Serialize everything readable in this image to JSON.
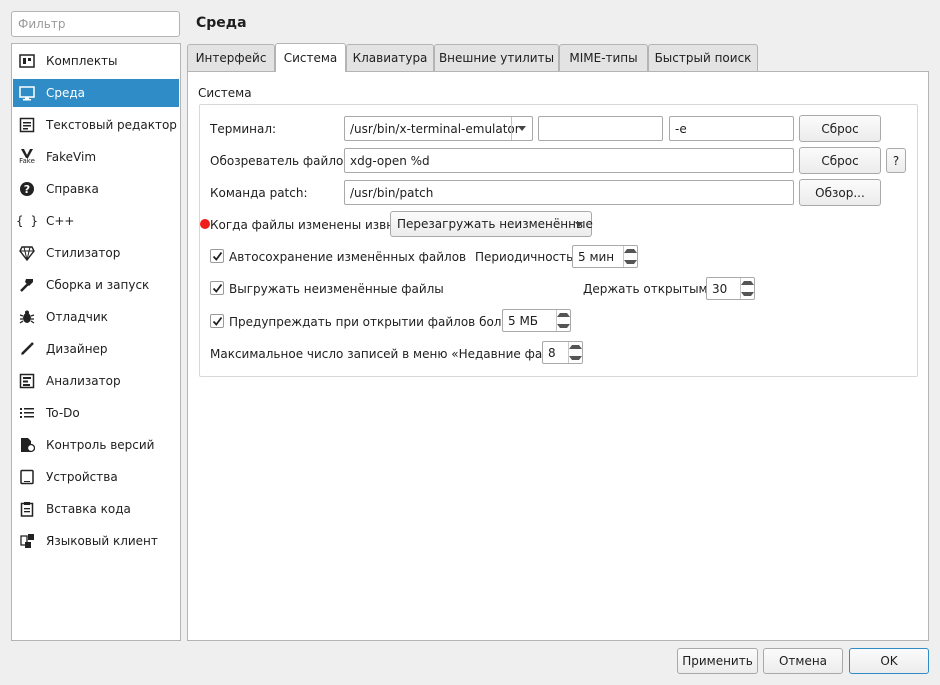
{
  "filter": {
    "placeholder": "Фильтр"
  },
  "sidebar": {
    "items": [
      {
        "label": "Комплекты",
        "icon": "kits-icon"
      },
      {
        "label": "Среда",
        "icon": "monitor-icon"
      },
      {
        "label": "Текстовый редактор",
        "icon": "text-editor-icon"
      },
      {
        "label": "FakeVim",
        "icon": "fakevim-icon",
        "icon_text": "Fake"
      },
      {
        "label": "Справка",
        "icon": "help-icon"
      },
      {
        "label": "C++",
        "icon": "braces-icon",
        "icon_text": "{ }"
      },
      {
        "label": "Стилизатор",
        "icon": "gem-icon"
      },
      {
        "label": "Сборка и запуск",
        "icon": "hammer-icon"
      },
      {
        "label": "Отладчик",
        "icon": "bug-icon"
      },
      {
        "label": "Дизайнер",
        "icon": "pencil-icon"
      },
      {
        "label": "Анализатор",
        "icon": "analyzer-icon"
      },
      {
        "label": "To-Do",
        "icon": "todo-list-icon"
      },
      {
        "label": "Контроль версий",
        "icon": "version-control-icon"
      },
      {
        "label": "Устройства",
        "icon": "devices-icon"
      },
      {
        "label": "Вставка кода",
        "icon": "code-paste-icon"
      },
      {
        "label": "Языковый клиент",
        "icon": "language-client-icon"
      }
    ],
    "selected": "Среда"
  },
  "page": {
    "title": "Среда"
  },
  "tabs": [
    {
      "label": "Интерфейс"
    },
    {
      "label": "Система"
    },
    {
      "label": "Клавиатура"
    },
    {
      "label": "Внешние утилиты"
    },
    {
      "label": "MIME-типы"
    },
    {
      "label": "Быстрый поиск"
    }
  ],
  "active_tab": "Система",
  "group": {
    "title": "Система"
  },
  "terminal": {
    "label": "Терминал:",
    "value": "/usr/bin/x-terminal-emulator",
    "extra": "",
    "arg": "-e",
    "reset": "Сброс"
  },
  "file_browser": {
    "label": "Обозреватель файлов:",
    "value": "xdg-open %d",
    "reset": "Сброс",
    "help": "?"
  },
  "patch": {
    "label": "Команда patch:",
    "value": "/usr/bin/patch",
    "browse": "Обзор..."
  },
  "files_changed": {
    "label": "Когда файлы изменены извне:",
    "value": "Перезагружать неизменённые"
  },
  "autosave": {
    "label": "Автосохранение изменённых файлов",
    "checked": true,
    "interval_label": "Периодичность:",
    "interval_value": "5 мин"
  },
  "unload": {
    "label": "Выгружать неизменённые файлы",
    "checked": true,
    "keep_label": "Держать открытыми:",
    "keep_value": "30"
  },
  "warn_large": {
    "label": "Предупреждать при открытии файлов больше",
    "checked": true,
    "value": "5 МБ"
  },
  "recent": {
    "label": "Максимальное число записей в меню «Недавние файлы»:",
    "value": "8"
  },
  "footer": {
    "apply": "Применить",
    "cancel": "Отмена",
    "ok": "OK"
  },
  "colors": {
    "accent": "#308cc6",
    "modified_indicator": "#f01c1c"
  }
}
